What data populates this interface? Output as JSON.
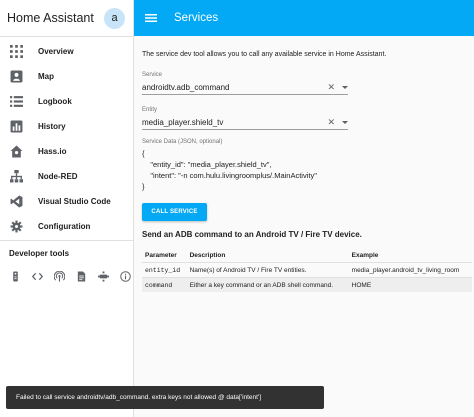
{
  "sidebar": {
    "title": "Home Assistant",
    "avatar_letter": "a",
    "items": [
      {
        "label": "Overview",
        "icon": "grid-icon"
      },
      {
        "label": "Map",
        "icon": "map-icon"
      },
      {
        "label": "Logbook",
        "icon": "list-icon"
      },
      {
        "label": "History",
        "icon": "chart-icon"
      },
      {
        "label": "Hass.io",
        "icon": "house-icon"
      },
      {
        "label": "Node-RED",
        "icon": "network-icon"
      },
      {
        "label": "Visual Studio Code",
        "icon": "code-icon"
      },
      {
        "label": "Configuration",
        "icon": "gear-icon"
      }
    ],
    "dev_tools_title": "Developer tools",
    "dev_tools_icons": [
      "remote-icon",
      "code-brackets-icon",
      "broadcast-icon",
      "file-icon",
      "template-icon",
      "info-icon"
    ]
  },
  "header": {
    "title": "Services"
  },
  "main": {
    "intro": "The service dev tool allows you to call any available service in Home Assistant.",
    "service": {
      "label": "Service",
      "value": "androidtv.adb_command"
    },
    "entity": {
      "label": "Entity",
      "value": "media_player.shield_tv"
    },
    "service_data": {
      "label": "Service Data (JSON, optional)",
      "lines": [
        "{",
        "    \"entity_id\": \"media_player.shield_tv\",",
        "    \"intent\": \"-n com.hulu.livingroomplus/.MainActivity\"",
        "}"
      ]
    },
    "call_button": "CALL SERVICE",
    "section_heading": "Send an ADB command to an Android TV / Fire TV device.",
    "table": {
      "headers": [
        "Parameter",
        "Description",
        "Example"
      ],
      "rows": [
        [
          "entity_id",
          "Name(s) of Android TV / Fire TV entities.",
          "media_player.android_tv_living_room"
        ],
        [
          "command",
          "Either a key command or an ADB shell command.",
          "HOME"
        ]
      ]
    }
  },
  "snackbar": {
    "message": "Failed to call service androidtv/adb_command. extra keys not allowed @ data['intent']"
  },
  "colors": {
    "accent": "#03a9f4",
    "snackbar": "#323232",
    "avatar": "#c8e4f8"
  }
}
